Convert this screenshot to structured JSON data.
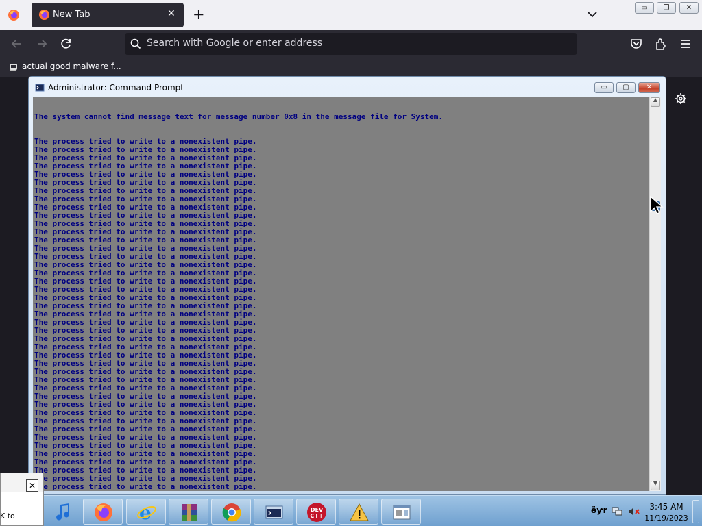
{
  "browser": {
    "tab": {
      "title": "New Tab",
      "close_glyph": "✕"
    },
    "new_tab_glyph": "+",
    "url_placeholder": "Search with Google or enter address",
    "bookmark": {
      "label": "actual good malware f..."
    },
    "window_controls": {
      "minimize": "▭",
      "restore": "❐",
      "close": "✕"
    }
  },
  "cmd_window": {
    "title": "Administrator: Command Prompt",
    "controls": {
      "minimize": "▭",
      "maximize": "▢",
      "close": "✕"
    },
    "first_line": "The system cannot find message text for message number 0x8 in the message file for System.",
    "repeated_line": "The process tried to write to a nonexistent pipe.",
    "repeated_count": 47,
    "scroll_position": 0.26,
    "colors": {
      "console_bg": "#808080",
      "console_text": "#000080"
    }
  },
  "dialog_fragment": {
    "close_glyph": "✕",
    "text": "K to"
  },
  "taskbar": {
    "apps": [
      "music-icon",
      "firefox-icon",
      "internet-explorer-icon",
      "winrar-icon",
      "chrome-icon",
      "command-prompt-icon",
      "dev-cpp-icon",
      "warning-icon",
      "notepad-icon"
    ],
    "devcpp_label": "DEV\nC++",
    "tray": {
      "indicator": "ӫƴr",
      "time": "3:45 AM",
      "date": "11/19/2023"
    }
  }
}
